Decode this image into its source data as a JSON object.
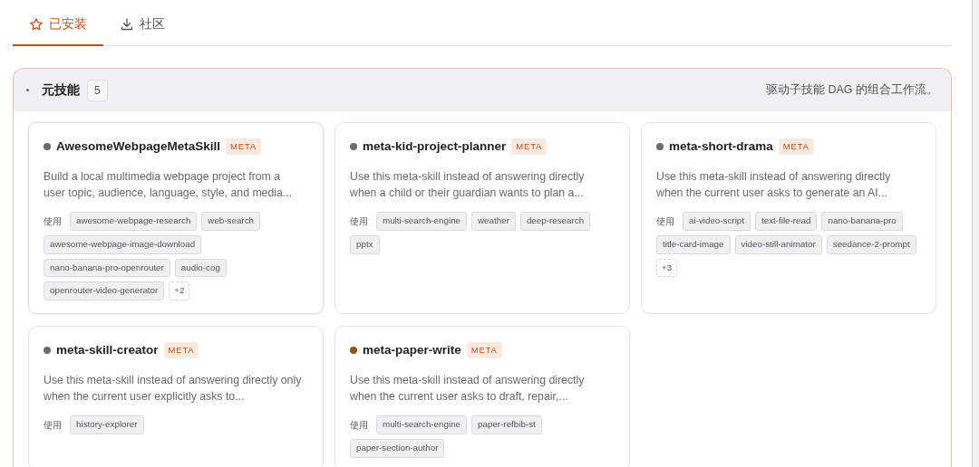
{
  "tabs": [
    {
      "label": "已安装",
      "selected": true
    },
    {
      "label": "社区",
      "selected": false
    }
  ],
  "section": {
    "title": "元技能",
    "count": "5",
    "description": "驱动子技能 DAG 的组合工作流。"
  },
  "skills": [
    {
      "name": "AwesomeWebpageMetaSkill",
      "color": "#6b6b70",
      "badge": "META",
      "description": "Build a local multimedia webpage project from a user topic, audience, language, style, and media...",
      "uses_label": "使用",
      "uses": [
        "awesome-webpage-research",
        "web-search",
        "awesome-webpage-image-download",
        "nano-banana-pro-openrouter",
        "audio-cog",
        "openrouter-video-generator"
      ],
      "more": "+2"
    },
    {
      "name": "meta-kid-project-planner",
      "color": "#6b6b70",
      "badge": "META",
      "description": "Use this meta-skill instead of answering directly when a child or their guardian wants to plan a...",
      "uses_label": "使用",
      "uses": [
        "multi-search-engine",
        "weather",
        "deep-research",
        "pptx"
      ]
    },
    {
      "name": "meta-short-drama",
      "color": "#6b6b70",
      "badge": "META",
      "description": "Use this meta-skill instead of answering directly when the current user asks to generate an AI...",
      "uses_label": "使用",
      "uses": [
        "ai-video-script",
        "text-file-read",
        "nano-banana-pro",
        "title-card-image",
        "video-still-animator",
        "seedance-2-prompt"
      ],
      "more": "+3"
    },
    {
      "name": "meta-skill-creator",
      "color": "#6b6b70",
      "badge": "META",
      "description": "Use this meta-skill instead of answering directly only when the current user explicitly asks to...",
      "uses_label": "使用",
      "uses": [
        "history-explorer"
      ]
    },
    {
      "name": "meta-paper-write",
      "color": "#8a5a12",
      "badge": "META",
      "description": "Use this meta-skill instead of answering directly when the current user asks to draft, repair,...",
      "uses_label": "使用",
      "uses": [
        "multi-search-engine",
        "paper-refbib-st",
        "paper-section-author"
      ]
    }
  ]
}
